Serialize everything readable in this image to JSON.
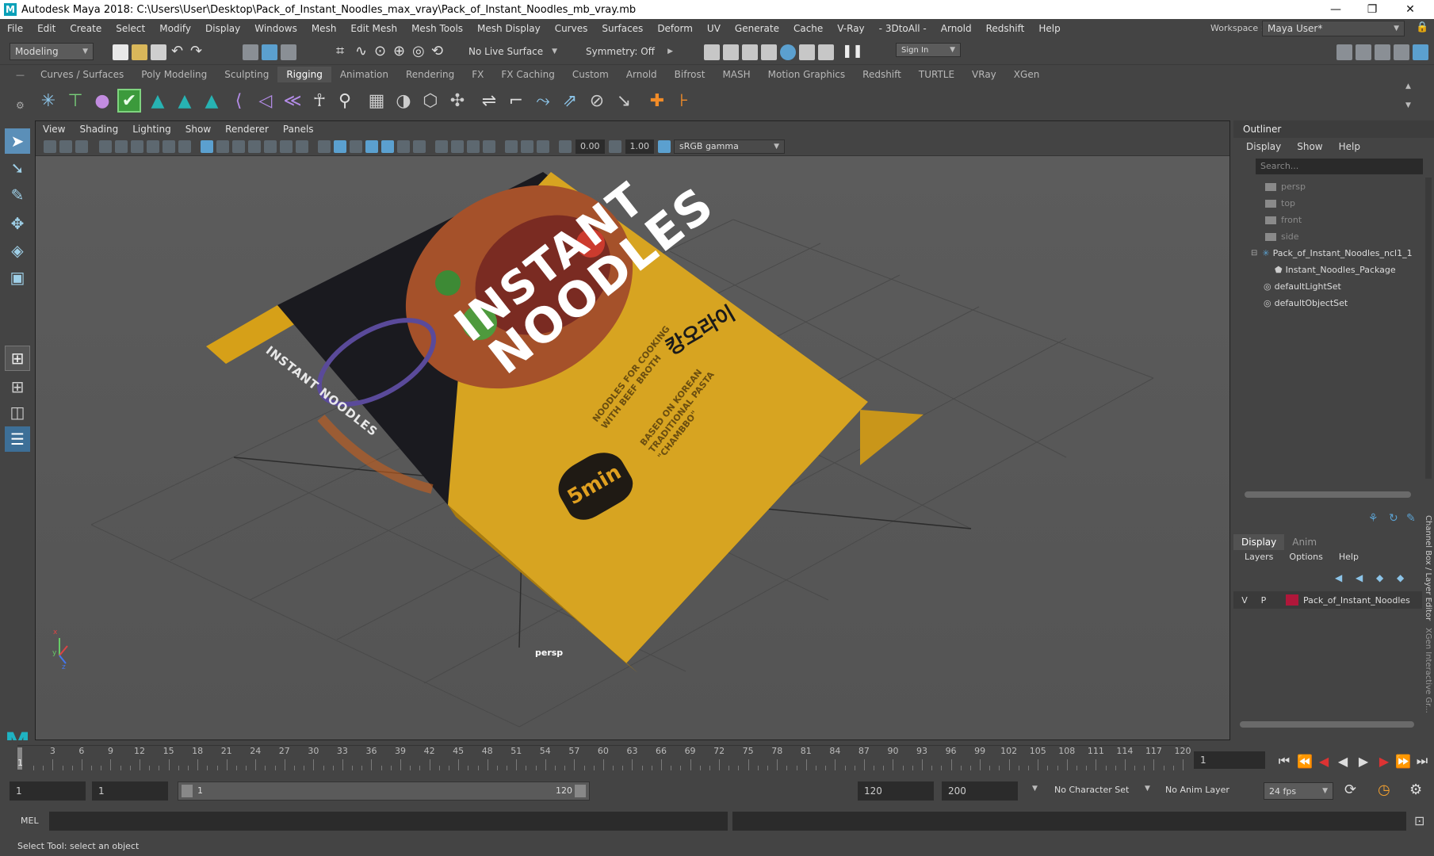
{
  "window": {
    "title": "Autodesk Maya 2018: C:\\Users\\User\\Desktop\\Pack_of_Instant_Noodles_max_vray\\Pack_of_Instant_Noodles_mb_vray.mb",
    "logo_letter": "M",
    "minimize": "—",
    "maximize": "❐",
    "close": "✕"
  },
  "menubar": [
    "File",
    "Edit",
    "Create",
    "Select",
    "Modify",
    "Display",
    "Windows",
    "Mesh",
    "Edit Mesh",
    "Mesh Tools",
    "Mesh Display",
    "Curves",
    "Surfaces",
    "Deform",
    "UV",
    "Generate",
    "Cache",
    "V-Ray",
    "- 3DtoAll -",
    "Arnold",
    "Redshift",
    "Help"
  ],
  "workspace": {
    "label": "Workspace :",
    "value": "Maya User*"
  },
  "statusline": {
    "mode": "Modeling",
    "live_surface": "No Live Surface",
    "symmetry": "Symmetry: Off",
    "sign_in": "Sign In"
  },
  "shelf_tabs": [
    "Curves / Surfaces",
    "Poly Modeling",
    "Sculpting",
    "Rigging",
    "Animation",
    "Rendering",
    "FX",
    "FX Caching",
    "Custom",
    "Arnold",
    "Bifrost",
    "MASH",
    "Motion Graphics",
    "Redshift",
    "TURTLE",
    "VRay",
    "XGen"
  ],
  "active_shelf_tab": "Rigging",
  "viewport": {
    "menu": [
      "View",
      "Shading",
      "Lighting",
      "Show",
      "Renderer",
      "Panels"
    ],
    "exposure": "0.00",
    "gamma": "1.00",
    "color_space": "sRGB gamma",
    "camera_label": "persp",
    "axis_x": "x",
    "axis_y": "y",
    "axis_z": "z"
  },
  "package": {
    "title_line1": "INSTANT",
    "title_line2": "NOODLES",
    "side_text": "INSTANT NOODLES",
    "sub1": "NOODLES FOR COOKING",
    "sub2": "WITH BEEF BROTH",
    "sub3": "BASED ON KOREAN",
    "sub4": "TRADITIONAL PASTA",
    "sub5": "\"CHAMBBO\"",
    "badge": "5min",
    "korean": "캉오라이"
  },
  "outliner": {
    "title": "Outliner",
    "menu": [
      "Display",
      "Show",
      "Help"
    ],
    "search_placeholder": "Search...",
    "items": [
      {
        "label": "persp",
        "dim": true
      },
      {
        "label": "top",
        "dim": true
      },
      {
        "label": "front",
        "dim": true
      },
      {
        "label": "side",
        "dim": true
      },
      {
        "label": "Pack_of_Instant_Noodles_ncl1_1",
        "dim": false
      },
      {
        "label": "Instant_Noodles_Package",
        "dim": false
      },
      {
        "label": "defaultLightSet",
        "dim": false
      },
      {
        "label": "defaultObjectSet",
        "dim": false
      }
    ]
  },
  "layer_editor": {
    "tabs": [
      "Display",
      "Anim"
    ],
    "menu": [
      "Layers",
      "Options",
      "Help"
    ],
    "layer": {
      "v": "V",
      "p": "P",
      "name": "Pack_of_Instant_Noodles",
      "color": "#b0173a"
    }
  },
  "side_tabs": {
    "channel_box": "Channel Box / Layer Editor",
    "xgen": "XGen Interactive Gr..."
  },
  "timeline": {
    "ticks": [
      "3",
      "6",
      "9",
      "12",
      "15",
      "18",
      "21",
      "24",
      "27",
      "30",
      "33",
      "36",
      "39",
      "42",
      "45",
      "48",
      "51",
      "54",
      "57",
      "60",
      "63",
      "66",
      "69",
      "72",
      "75",
      "78",
      "81",
      "84",
      "87",
      "90",
      "93",
      "96",
      "99",
      "102",
      "105",
      "108",
      "111",
      "114",
      "117",
      "120"
    ],
    "current_frame": "1",
    "current_marker": "1"
  },
  "range": {
    "start": "1",
    "playback_start": "1",
    "slider_start": "1",
    "slider_end": "120",
    "playback_end": "120",
    "end": "200",
    "character_set": "No Character Set",
    "anim_layer": "No Anim Layer",
    "fps": "24 fps"
  },
  "cmdline": {
    "label": "MEL"
  },
  "helpline": "Select Tool: select an object",
  "colors": {
    "accent": "#5ba0cf",
    "package_yellow": "#d9a620",
    "package_dark": "#1a1a1f"
  }
}
